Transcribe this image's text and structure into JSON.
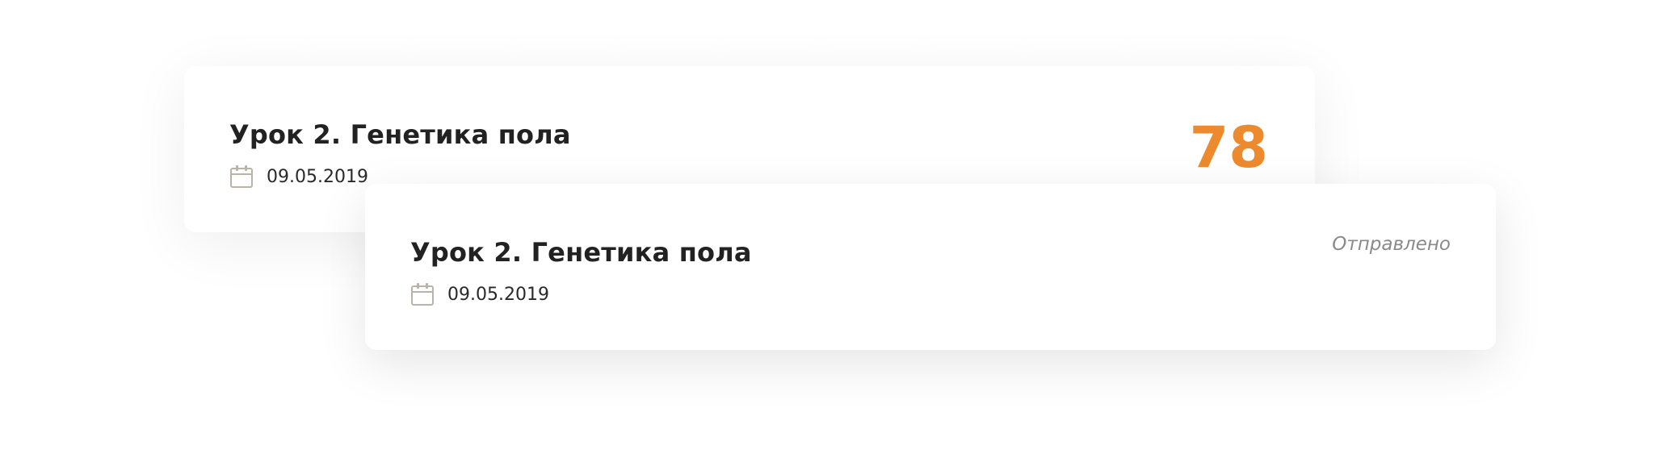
{
  "cards": [
    {
      "title": "Урок 2. Генетика пола",
      "date": "09.05.2019",
      "icon": "calendar-icon",
      "score": "78"
    },
    {
      "title": "Урок 2. Генетика пола",
      "date": "09.05.2019",
      "icon": "calendar-icon",
      "status": "Отправлено"
    }
  ],
  "colors": {
    "score": "#ee8a2e",
    "calendar_icon": "#b9b4a8"
  }
}
